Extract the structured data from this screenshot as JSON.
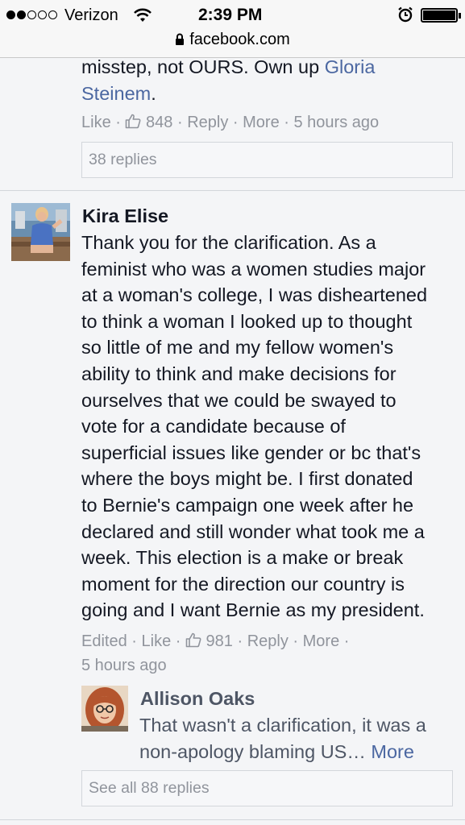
{
  "status_bar": {
    "carrier": "Verizon",
    "time": "2:39 PM"
  },
  "url_bar": {
    "domain": "facebook.com"
  },
  "top_comment": {
    "text_plain": "misstep, not OURS. Own up ",
    "mention": "Gloria Steinem",
    "text_end": ".",
    "like_label": "Like",
    "like_count": "848",
    "reply_label": "Reply",
    "more_label": "More",
    "timestamp": "5 hours ago",
    "replies_label": "38 replies"
  },
  "kira_comment": {
    "author": "Kira Elise",
    "lines": [
      "Thank you for the clarification. As a",
      "feminist who was a women studies major",
      "at a woman's college, I was disheartened",
      "to think a woman I looked up to thought",
      "so little of me and my fellow women's",
      "ability to think and make decisions for",
      "ourselves that we could be swayed to",
      "vote for a candidate because of",
      "superficial issues like gender or bc that's",
      "where the boys might be. I first donated",
      "to Bernie's campaign one week after he",
      "declared and still wonder what took me a",
      "week. This election is a make or break",
      "moment for the direction our country is",
      "going and I want Bernie as my president."
    ],
    "edited_label": "Edited",
    "like_label": "Like",
    "like_count": "981",
    "reply_label": "Reply",
    "more_label": "More",
    "timestamp": "5 hours ago"
  },
  "allison_reply": {
    "author": "Allison Oaks",
    "line1": "That wasn't a clarification, it was a",
    "line2": "non-apology blaming US… ",
    "more_link": "More",
    "see_all_label": "See all 88 replies"
  },
  "colors": {
    "link": "#4b67a1",
    "meta": "#90949c",
    "text": "#141823"
  }
}
